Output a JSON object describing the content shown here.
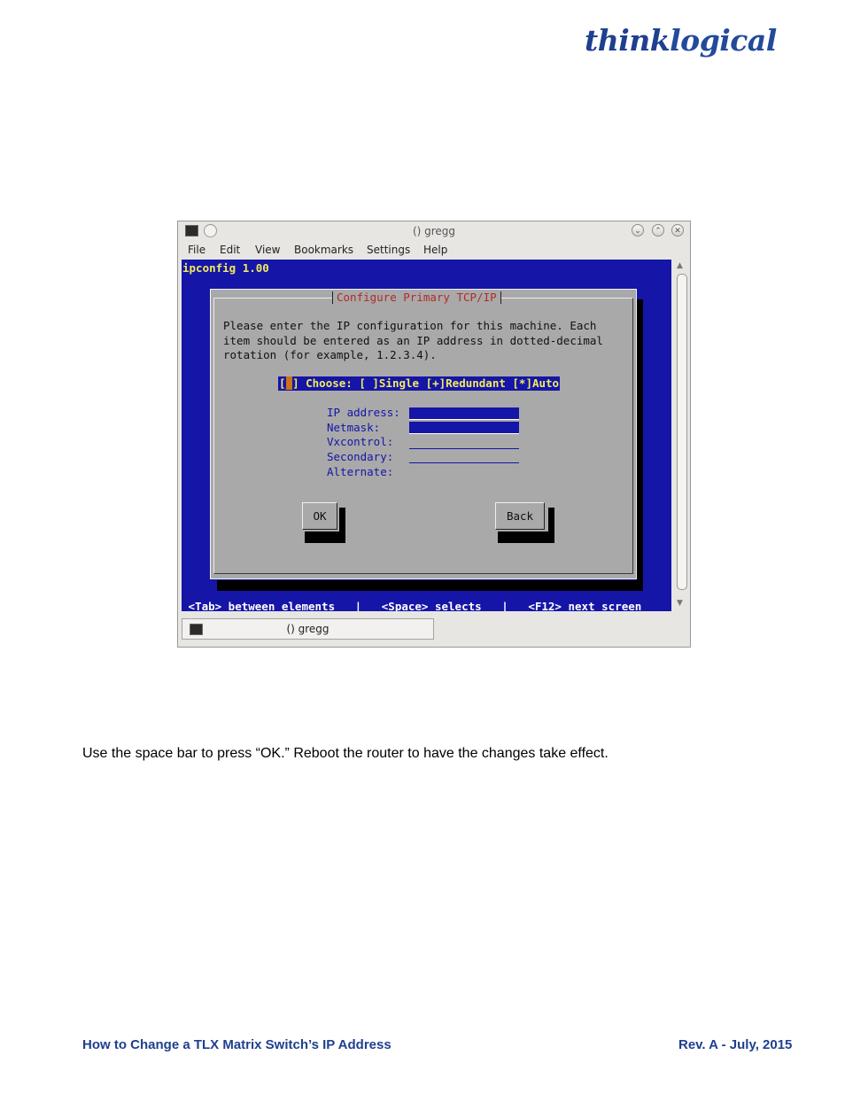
{
  "header": {
    "logo_think": "think",
    "logo_logical": "logical"
  },
  "window": {
    "title": "() gregg",
    "menu": [
      "File",
      "Edit",
      "View",
      "Bookmarks",
      "Settings",
      "Help"
    ],
    "tab_label": "() gregg"
  },
  "terminal": {
    "app_title": "ipconfig 1.00",
    "dialog_title": "Configure Primary TCP/IP",
    "body_lines": [
      "Please enter the IP configuration for this machine. Each",
      "item should be entered as an IP address in dotted-decimal",
      "rotation (for example, 1.2.3.4)."
    ],
    "choose_line": "] Choose: [ ]Single [+]Redundant [*]Auto",
    "choose_open": "[",
    "fields": [
      {
        "label": "IP address:",
        "value": ""
      },
      {
        "label": "Netmask:",
        "value": ""
      },
      {
        "label": "Vxcontrol:",
        "value": ""
      },
      {
        "label": "Secondary:",
        "value": ""
      },
      {
        "label": "Alternate:",
        "value": ""
      }
    ],
    "ok_label": "OK",
    "back_label": "Back",
    "status_line": " <Tab> between elements   |   <Space> selects   |   <F12> next screen"
  },
  "document": {
    "instruction": "Use the space bar to press “OK.” Reboot the router to have the changes take effect.",
    "footer_left": "How to Change a TLX Matrix Switch’s IP Address",
    "footer_right": "Rev. A - July, 2015"
  },
  "colors": {
    "brand": "#1f3f8f",
    "terminal_bg": "#1515a8",
    "dialog_bg": "#a9a9a9",
    "dialog_title": "#b22a2a",
    "highlight_text": "#f2ec5a"
  }
}
